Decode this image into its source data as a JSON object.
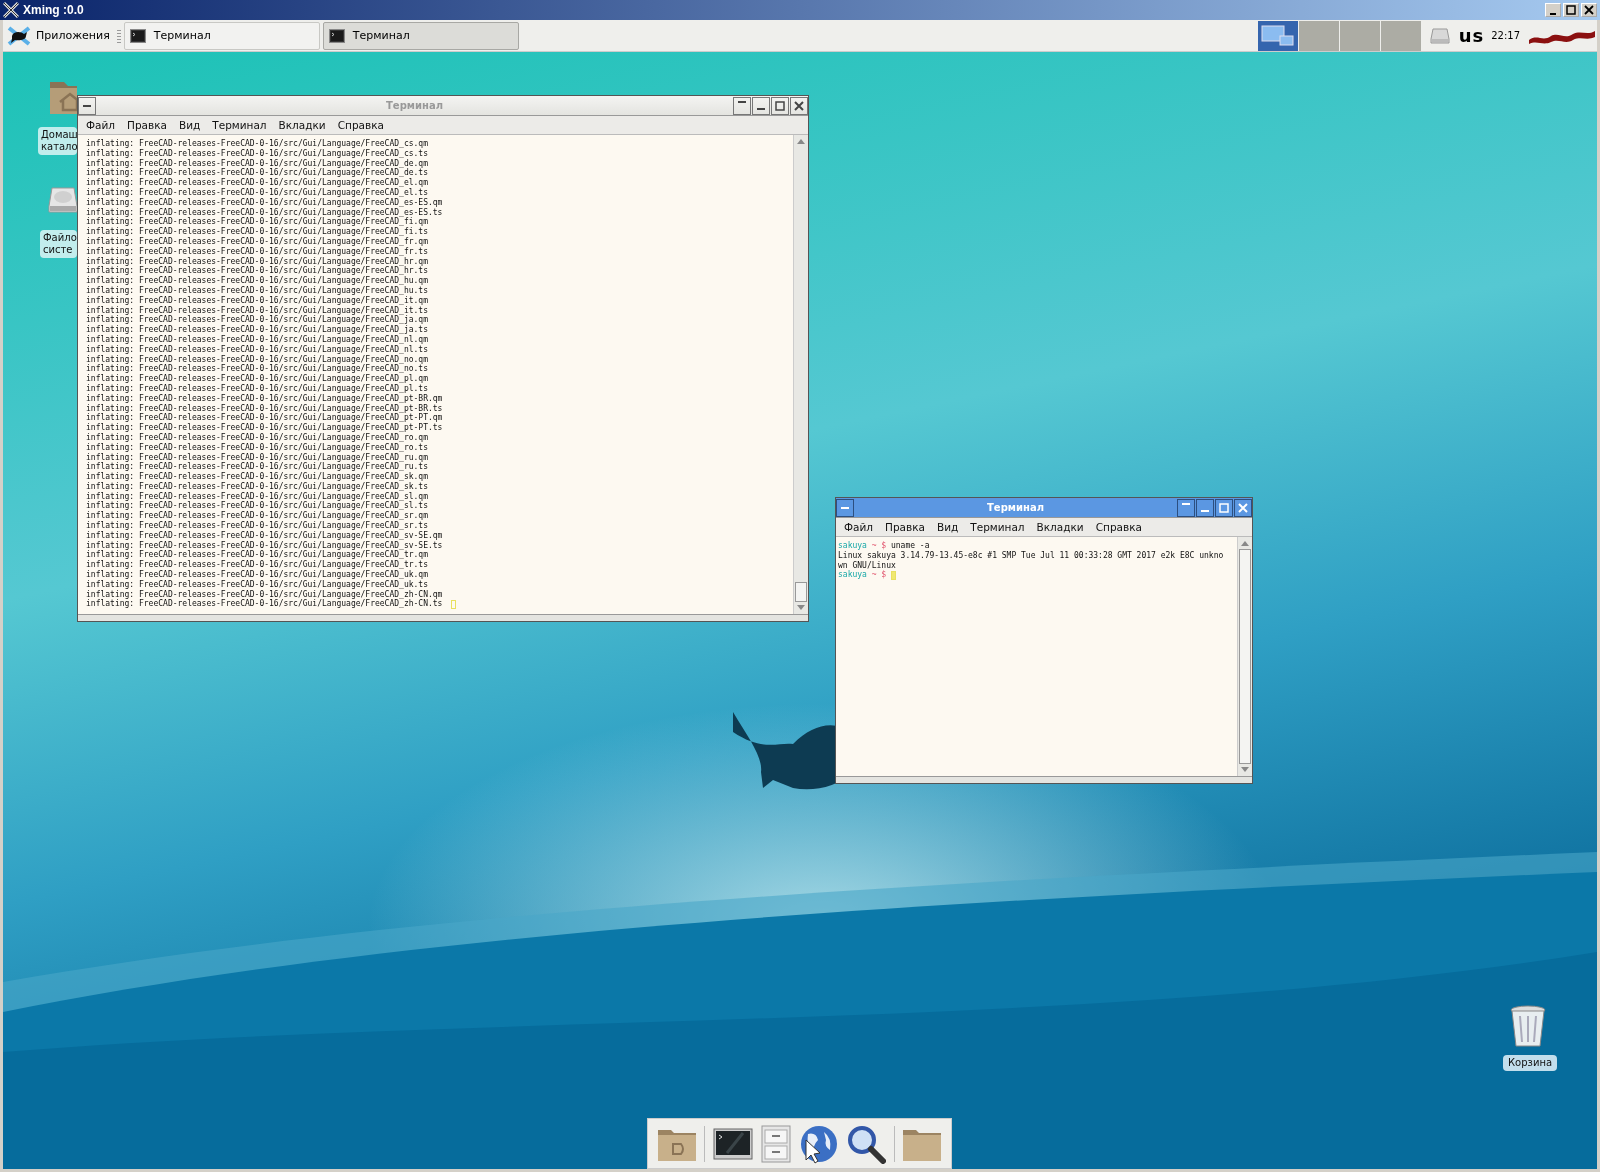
{
  "xming_window": {
    "title": "Xming :0.0"
  },
  "taskbar": {
    "apps_menu": "Приложения",
    "tasks": [
      {
        "label": "Терминал",
        "selected": false
      },
      {
        "label": "Терминал",
        "selected": true
      }
    ],
    "workspaces": [
      {
        "selected": true
      },
      {
        "selected": false
      },
      {
        "selected": false
      },
      {
        "selected": false
      }
    ],
    "keyboard_layout": "us",
    "clock": "22:17"
  },
  "desktop_icons": [
    {
      "kind": "home",
      "lines": [
        "Домаш",
        "катало"
      ]
    },
    {
      "kind": "drive",
      "lines": [
        "Файло",
        "систе"
      ]
    },
    {
      "kind": "trash",
      "lines": [
        "Корзина"
      ]
    }
  ],
  "windows": [
    {
      "title": "Терминал",
      "active": false,
      "cursor": true,
      "menu": [
        "Файл",
        "Правка",
        "Вид",
        "Терминал",
        "Вкладки",
        "Справка"
      ],
      "lines": [
        {
          "kind": "output",
          "text": "inflating: FreeCAD-releases-FreeCAD-0-16/src/Gui/Language/FreeCAD_cs.qm"
        },
        {
          "kind": "output",
          "text": "inflating: FreeCAD-releases-FreeCAD-0-16/src/Gui/Language/FreeCAD_cs.ts"
        },
        {
          "kind": "output",
          "text": "inflating: FreeCAD-releases-FreeCAD-0-16/src/Gui/Language/FreeCAD_de.qm"
        },
        {
          "kind": "output",
          "text": "inflating: FreeCAD-releases-FreeCAD-0-16/src/Gui/Language/FreeCAD_de.ts"
        },
        {
          "kind": "output",
          "text": "inflating: FreeCAD-releases-FreeCAD-0-16/src/Gui/Language/FreeCAD_el.qm"
        },
        {
          "kind": "output",
          "text": "inflating: FreeCAD-releases-FreeCAD-0-16/src/Gui/Language/FreeCAD_el.ts"
        },
        {
          "kind": "output",
          "text": "inflating: FreeCAD-releases-FreeCAD-0-16/src/Gui/Language/FreeCAD_es-ES.qm"
        },
        {
          "kind": "output",
          "text": "inflating: FreeCAD-releases-FreeCAD-0-16/src/Gui/Language/FreeCAD_es-ES.ts"
        },
        {
          "kind": "output",
          "text": "inflating: FreeCAD-releases-FreeCAD-0-16/src/Gui/Language/FreeCAD_fi.qm"
        },
        {
          "kind": "output",
          "text": "inflating: FreeCAD-releases-FreeCAD-0-16/src/Gui/Language/FreeCAD_fi.ts"
        },
        {
          "kind": "output",
          "text": "inflating: FreeCAD-releases-FreeCAD-0-16/src/Gui/Language/FreeCAD_fr.qm"
        },
        {
          "kind": "output",
          "text": "inflating: FreeCAD-releases-FreeCAD-0-16/src/Gui/Language/FreeCAD_fr.ts"
        },
        {
          "kind": "output",
          "text": "inflating: FreeCAD-releases-FreeCAD-0-16/src/Gui/Language/FreeCAD_hr.qm"
        },
        {
          "kind": "output",
          "text": "inflating: FreeCAD-releases-FreeCAD-0-16/src/Gui/Language/FreeCAD_hr.ts"
        },
        {
          "kind": "output",
          "text": "inflating: FreeCAD-releases-FreeCAD-0-16/src/Gui/Language/FreeCAD_hu.qm"
        },
        {
          "kind": "output",
          "text": "inflating: FreeCAD-releases-FreeCAD-0-16/src/Gui/Language/FreeCAD_hu.ts"
        },
        {
          "kind": "output",
          "text": "inflating: FreeCAD-releases-FreeCAD-0-16/src/Gui/Language/FreeCAD_it.qm"
        },
        {
          "kind": "output",
          "text": "inflating: FreeCAD-releases-FreeCAD-0-16/src/Gui/Language/FreeCAD_it.ts"
        },
        {
          "kind": "output",
          "text": "inflating: FreeCAD-releases-FreeCAD-0-16/src/Gui/Language/FreeCAD_ja.qm"
        },
        {
          "kind": "output",
          "text": "inflating: FreeCAD-releases-FreeCAD-0-16/src/Gui/Language/FreeCAD_ja.ts"
        },
        {
          "kind": "output",
          "text": "inflating: FreeCAD-releases-FreeCAD-0-16/src/Gui/Language/FreeCAD_nl.qm"
        },
        {
          "kind": "output",
          "text": "inflating: FreeCAD-releases-FreeCAD-0-16/src/Gui/Language/FreeCAD_nl.ts"
        },
        {
          "kind": "output",
          "text": "inflating: FreeCAD-releases-FreeCAD-0-16/src/Gui/Language/FreeCAD_no.qm"
        },
        {
          "kind": "output",
          "text": "inflating: FreeCAD-releases-FreeCAD-0-16/src/Gui/Language/FreeCAD_no.ts"
        },
        {
          "kind": "output",
          "text": "inflating: FreeCAD-releases-FreeCAD-0-16/src/Gui/Language/FreeCAD_pl.qm"
        },
        {
          "kind": "output",
          "text": "inflating: FreeCAD-releases-FreeCAD-0-16/src/Gui/Language/FreeCAD_pl.ts"
        },
        {
          "kind": "output",
          "text": "inflating: FreeCAD-releases-FreeCAD-0-16/src/Gui/Language/FreeCAD_pt-BR.qm"
        },
        {
          "kind": "output",
          "text": "inflating: FreeCAD-releases-FreeCAD-0-16/src/Gui/Language/FreeCAD_pt-BR.ts"
        },
        {
          "kind": "output",
          "text": "inflating: FreeCAD-releases-FreeCAD-0-16/src/Gui/Language/FreeCAD_pt-PT.qm"
        },
        {
          "kind": "output",
          "text": "inflating: FreeCAD-releases-FreeCAD-0-16/src/Gui/Language/FreeCAD_pt-PT.ts"
        },
        {
          "kind": "output",
          "text": "inflating: FreeCAD-releases-FreeCAD-0-16/src/Gui/Language/FreeCAD_ro.qm"
        },
        {
          "kind": "output",
          "text": "inflating: FreeCAD-releases-FreeCAD-0-16/src/Gui/Language/FreeCAD_ro.ts"
        },
        {
          "kind": "output",
          "text": "inflating: FreeCAD-releases-FreeCAD-0-16/src/Gui/Language/FreeCAD_ru.qm"
        },
        {
          "kind": "output",
          "text": "inflating: FreeCAD-releases-FreeCAD-0-16/src/Gui/Language/FreeCAD_ru.ts"
        },
        {
          "kind": "output",
          "text": "inflating: FreeCAD-releases-FreeCAD-0-16/src/Gui/Language/FreeCAD_sk.qm"
        },
        {
          "kind": "output",
          "text": "inflating: FreeCAD-releases-FreeCAD-0-16/src/Gui/Language/FreeCAD_sk.ts"
        },
        {
          "kind": "output",
          "text": "inflating: FreeCAD-releases-FreeCAD-0-16/src/Gui/Language/FreeCAD_sl.qm"
        },
        {
          "kind": "output",
          "text": "inflating: FreeCAD-releases-FreeCAD-0-16/src/Gui/Language/FreeCAD_sl.ts"
        },
        {
          "kind": "output",
          "text": "inflating: FreeCAD-releases-FreeCAD-0-16/src/Gui/Language/FreeCAD_sr.qm"
        },
        {
          "kind": "output",
          "text": "inflating: FreeCAD-releases-FreeCAD-0-16/src/Gui/Language/FreeCAD_sr.ts"
        },
        {
          "kind": "output",
          "text": "inflating: FreeCAD-releases-FreeCAD-0-16/src/Gui/Language/FreeCAD_sv-SE.qm"
        },
        {
          "kind": "output",
          "text": "inflating: FreeCAD-releases-FreeCAD-0-16/src/Gui/Language/FreeCAD_sv-SE.ts"
        },
        {
          "kind": "output",
          "text": "inflating: FreeCAD-releases-FreeCAD-0-16/src/Gui/Language/FreeCAD_tr.qm"
        },
        {
          "kind": "output",
          "text": "inflating: FreeCAD-releases-FreeCAD-0-16/src/Gui/Language/FreeCAD_tr.ts"
        },
        {
          "kind": "output",
          "text": "inflating: FreeCAD-releases-FreeCAD-0-16/src/Gui/Language/FreeCAD_uk.qm"
        },
        {
          "kind": "output",
          "text": "inflating: FreeCAD-releases-FreeCAD-0-16/src/Gui/Language/FreeCAD_uk.ts"
        },
        {
          "kind": "output",
          "text": "inflating: FreeCAD-releases-FreeCAD-0-16/src/Gui/Language/FreeCAD_zh-CN.qm"
        },
        {
          "kind": "output",
          "text": "inflating: FreeCAD-releases-FreeCAD-0-16/src/Gui/Language/FreeCAD_zh-CN.ts"
        }
      ]
    },
    {
      "title": "Терминал",
      "active": true,
      "cursor": true,
      "menu": [
        "Файл",
        "Правка",
        "Вид",
        "Терминал",
        "Вкладки",
        "Справка"
      ],
      "lines": [
        {
          "kind": "prompt",
          "user": "sakuya",
          "path": "~",
          "symbol": "$",
          "command": "uname -a"
        },
        {
          "kind": "output",
          "text": "Linux sakuya 3.14.79-13.45-e8c #1 SMP Tue Jul 11 00:33:28 GMT 2017 e2k E8C unkno"
        },
        {
          "kind": "output",
          "text": "wn GNU/Linux"
        },
        {
          "kind": "prompt",
          "user": "sakuya",
          "path": "~",
          "symbol": "$"
        }
      ]
    }
  ],
  "dock": [
    {
      "kind": "home-folder"
    },
    {
      "kind": "separator"
    },
    {
      "kind": "terminal"
    },
    {
      "kind": "cabinet"
    },
    {
      "kind": "globe"
    },
    {
      "kind": "search"
    },
    {
      "kind": "separator"
    },
    {
      "kind": "folder"
    }
  ]
}
